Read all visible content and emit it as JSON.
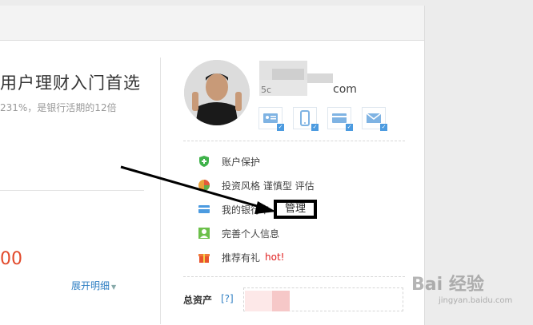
{
  "product": {
    "title": "用户理财入门首选",
    "subtitle": "231%，是银行活期的12倍",
    "amount": "00",
    "expand_label": "展开明细"
  },
  "user": {
    "email_first": "5c",
    "email_suffix": "com",
    "verify_icons": [
      "id-card-icon",
      "phone-icon",
      "bank-card-icon",
      "mail-icon"
    ]
  },
  "menu": {
    "account_protection": "账户保护",
    "investment_style": "投资风格 谨慎型 评估",
    "my_bank": "我的银行卡",
    "manage": "管理",
    "complete_info": "完善个人信息",
    "referral": "推荐有礼",
    "hot": "hot!"
  },
  "assets": {
    "label": "总资产",
    "help": "[?]"
  },
  "watermark": {
    "text": "Bai 经验",
    "sub": "jingyan.baidu.com"
  },
  "colors": {
    "accent_blue": "#2f7fc3",
    "amount_red": "#e24a2b",
    "hot_red": "#e02020"
  }
}
